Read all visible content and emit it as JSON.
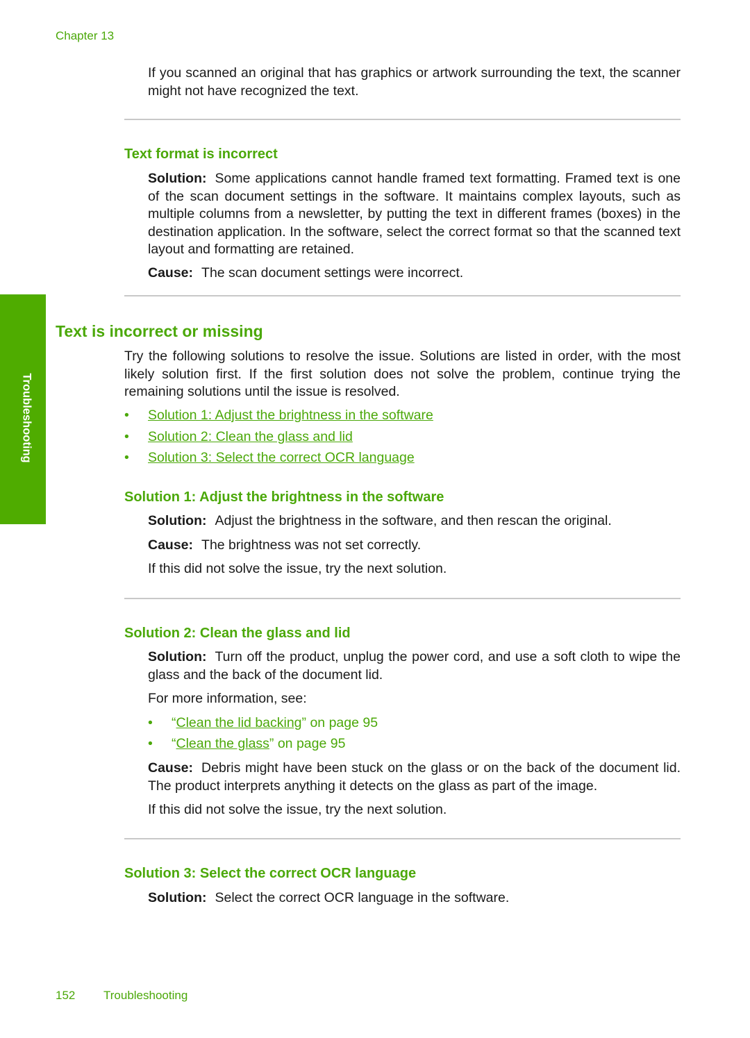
{
  "header": {
    "chapter": "Chapter 13"
  },
  "side_tab": {
    "label": "Troubleshooting",
    "color": "#4fac00"
  },
  "accent_color": "#4ba809",
  "intro": {
    "text": "If you scanned an original that has graphics or artwork surrounding the text, the scanner might not have recognized the text."
  },
  "text_format": {
    "heading": "Text format is incorrect",
    "solution_label": "Solution:",
    "solution_text": "Some applications cannot handle framed text formatting. Framed text is one of the scan document settings in the software. It maintains complex layouts, such as multiple columns from a newsletter, by putting the text in different frames (boxes) in the destination application. In the software, select the correct format so that the scanned text layout and formatting are retained.",
    "cause_label": "Cause:",
    "cause_text": "The scan document settings were incorrect."
  },
  "text_missing": {
    "heading": "Text is incorrect or missing",
    "intro": "Try the following solutions to resolve the issue. Solutions are listed in order, with the most likely solution first. If the first solution does not solve the problem, continue trying the remaining solutions until the issue is resolved.",
    "links": [
      {
        "label": "Solution 1: Adjust the brightness in the software"
      },
      {
        "label": "Solution 2: Clean the glass and lid"
      },
      {
        "label": "Solution 3: Select the correct OCR language"
      }
    ]
  },
  "solution1": {
    "heading": "Solution 1: Adjust the brightness in the software",
    "solution_label": "Solution:",
    "solution_text": "Adjust the brightness in the software, and then rescan the original.",
    "cause_label": "Cause:",
    "cause_text": "The brightness was not set correctly.",
    "next": "If this did not solve the issue, try the next solution."
  },
  "solution2": {
    "heading": "Solution 2: Clean the glass and lid",
    "solution_label": "Solution:",
    "solution_text": "Turn off the product, unplug the power cord, and use a soft cloth to wipe the glass and the back of the document lid.",
    "more_info": "For more information, see:",
    "refs": [
      {
        "open_quote": "“",
        "link": "Clean the lid backing",
        "close": "” on page 95"
      },
      {
        "open_quote": "“",
        "link": "Clean the glass",
        "close": "” on page 95"
      }
    ],
    "cause_label": "Cause:",
    "cause_text": "Debris might have been stuck on the glass or on the back of the document lid. The product interprets anything it detects on the glass as part of the image.",
    "next": "If this did not solve the issue, try the next solution."
  },
  "solution3": {
    "heading": "Solution 3: Select the correct OCR language",
    "solution_label": "Solution:",
    "solution_text": "Select the correct OCR language in the software."
  },
  "footer": {
    "page_number": "152",
    "section": "Troubleshooting"
  }
}
